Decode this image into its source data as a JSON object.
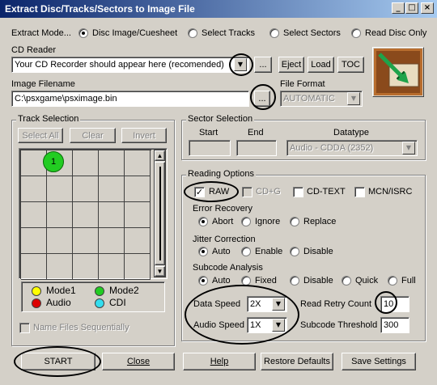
{
  "window": {
    "title": "Extract Disc/Tracks/Sectors to Image File",
    "controls": {
      "minimize": "_",
      "maximize": "□",
      "close": "×"
    }
  },
  "extract_mode": {
    "label": "Extract Mode...",
    "options": [
      {
        "label": "Disc Image/Cuesheet",
        "selected": true
      },
      {
        "label": "Select Tracks",
        "selected": false
      },
      {
        "label": "Select Sectors",
        "selected": false
      },
      {
        "label": "Read Disc Only",
        "selected": false
      }
    ]
  },
  "cd_reader": {
    "label": "CD Reader",
    "value": "Your CD Recorder should appear here (recomended)",
    "browse_label": "...",
    "eject_label": "Eject",
    "load_label": "Load",
    "toc_label": "TOC"
  },
  "image_filename": {
    "label": "Image Filename",
    "value": "C:\\psxgame\\psximage.bin",
    "browse_label": "..."
  },
  "file_format": {
    "label": "File Format",
    "value": "AUTOMATIC"
  },
  "track_selection": {
    "label": "Track Selection",
    "select_all_label": "Select All",
    "clear_label": "Clear",
    "invert_label": "Invert",
    "first_track_number": "1",
    "legend": [
      {
        "label": "Mode1",
        "color": "#ffff00"
      },
      {
        "label": "Mode2",
        "color": "#22cc22"
      },
      {
        "label": "Audio",
        "color": "#dd0000"
      },
      {
        "label": "CDI",
        "color": "#33ddee"
      }
    ],
    "name_files_label": "Name Files Sequentially"
  },
  "sector_selection": {
    "label": "Sector Selection",
    "start_label": "Start",
    "end_label": "End",
    "datatype_label": "Datatype",
    "datatype_value": "Audio - CDDA (2352)"
  },
  "reading_options": {
    "label": "Reading Options",
    "raw_label": "RAW",
    "raw_checked": true,
    "cdg_label": "CD+G",
    "cdtext_label": "CD-TEXT",
    "mcn_label": "MCN/ISRC",
    "error_recovery": {
      "label": "Error Recovery",
      "options": [
        {
          "label": "Abort",
          "selected": true
        },
        {
          "label": "Ignore",
          "selected": false
        },
        {
          "label": "Replace",
          "selected": false
        }
      ]
    },
    "jitter_correction": {
      "label": "Jitter Correction",
      "options": [
        {
          "label": "Auto",
          "selected": true
        },
        {
          "label": "Enable",
          "selected": false
        },
        {
          "label": "Disable",
          "selected": false
        }
      ]
    },
    "subcode_analysis": {
      "label": "Subcode Analysis",
      "options": [
        {
          "label": "Auto",
          "selected": true
        },
        {
          "label": "Fixed",
          "selected": false
        },
        {
          "label": "Disable",
          "selected": false
        },
        {
          "label": "Quick",
          "selected": false
        },
        {
          "label": "Full",
          "selected": false
        }
      ]
    },
    "data_speed_label": "Data Speed",
    "data_speed_value": "2X",
    "audio_speed_label": "Audio Speed",
    "audio_speed_value": "1X",
    "read_retry_label": "Read Retry Count",
    "read_retry_value": "10",
    "subcode_threshold_label": "Subcode Threshold",
    "subcode_threshold_value": "300"
  },
  "footer": {
    "start_label": "START",
    "close_label": "Close",
    "help_label": "Help",
    "restore_label": "Restore Defaults",
    "save_label": "Save Settings"
  }
}
